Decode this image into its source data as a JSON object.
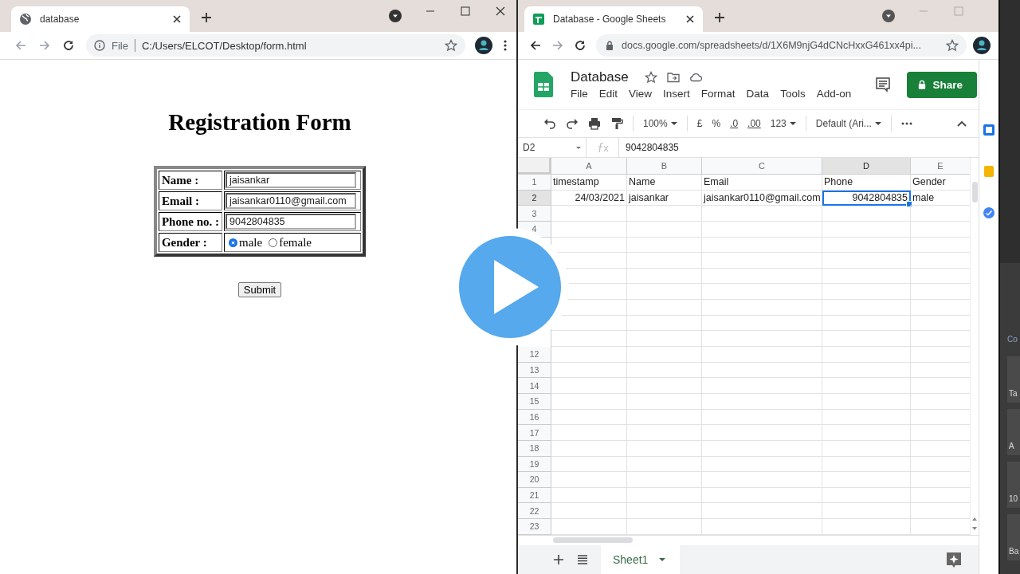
{
  "left_window": {
    "tab": {
      "title": "database"
    },
    "address_bar": {
      "scheme": "File",
      "url": "C:/Users/ELCOT/Desktop/form.html"
    },
    "page": {
      "heading": "Registration Form",
      "fields": [
        {
          "kind": "text",
          "label": "Name :",
          "value": "jaisankar"
        },
        {
          "kind": "text",
          "label": "Email :",
          "value": "jaisankar0110@gmail.com"
        },
        {
          "kind": "text",
          "label": "Phone no. :",
          "value": "9042804835"
        },
        {
          "kind": "radio",
          "label": "Gender :",
          "options": [
            {
              "label": "male",
              "selected": true
            },
            {
              "label": "female",
              "selected": false
            }
          ]
        }
      ],
      "submit_button": "Submit"
    }
  },
  "right_window": {
    "tab": {
      "title": "Database - Google Sheets"
    },
    "address_bar": {
      "url": "docs.google.com/spreadsheets/d/1X6M9njG4dCNcHxxG461xx4pi..."
    },
    "sheets": {
      "doc_title": "Database",
      "menu": [
        "File",
        "Edit",
        "View",
        "Insert",
        "Format",
        "Data",
        "Tools",
        "Add-on"
      ],
      "share_button": "Share",
      "toolbar": {
        "zoom": "100%",
        "currency": "£",
        "percent": "%",
        "decrease_decimals": ".0",
        "increase_decimals": ".00",
        "more_formats": "123",
        "font": "Default (Ari..."
      },
      "name_box": "D2",
      "formula": "9042804835",
      "columns": [
        "A",
        "B",
        "C",
        "D",
        "E"
      ],
      "rows": [
        {
          "number": "1",
          "cells": [
            {
              "text": "timestamp",
              "kind": "text",
              "selected": false
            },
            {
              "text": "Name",
              "kind": "text",
              "selected": false
            },
            {
              "text": "Email",
              "kind": "text",
              "selected": false
            },
            {
              "text": "Phone",
              "kind": "text",
              "selected": false
            },
            {
              "text": "Gender",
              "kind": "text",
              "selected": false
            }
          ]
        },
        {
          "number": "2",
          "cells": [
            {
              "text": "24/03/2021",
              "kind": "number",
              "selected": false
            },
            {
              "text": "jaisankar",
              "kind": "text",
              "selected": false
            },
            {
              "text": "jaisankar0110@gmail.com",
              "kind": "text",
              "selected": false
            },
            {
              "text": "9042804835",
              "kind": "number",
              "selected": true
            },
            {
              "text": "male",
              "kind": "text",
              "selected": false
            }
          ]
        },
        {
          "number": "3"
        },
        {
          "number": "4"
        },
        {},
        {},
        {},
        {},
        {},
        {},
        {},
        {
          "number": "12"
        },
        {
          "number": "13"
        },
        {
          "number": "14"
        },
        {
          "number": "15"
        },
        {
          "number": "16"
        },
        {
          "number": "17"
        },
        {
          "number": "18"
        },
        {
          "number": "19"
        },
        {
          "number": "20"
        },
        {
          "number": "21"
        },
        {
          "number": "22"
        },
        {
          "number": "23"
        }
      ],
      "sheet_tab": "Sheet1"
    }
  },
  "side_strip": [
    "Co",
    "Ta",
    "A",
    "10",
    "Ba"
  ]
}
